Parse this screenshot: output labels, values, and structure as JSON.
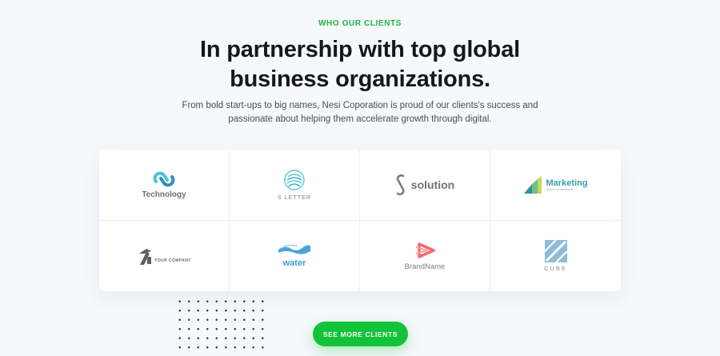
{
  "section": {
    "eyebrow": "WHO OUR CLIENTS",
    "headline_line1": "In partnership with top global",
    "headline_line2": "business organizations.",
    "subtext_line1": "From bold start-ups to big names, Nesi Coporation is proud of our clients's success and",
    "subtext_line2": "passionate about helping them accelerate growth through digital."
  },
  "clients": [
    {
      "name": "Technology",
      "icon": "technology-logo-icon"
    },
    {
      "name": "S LETTER",
      "icon": "s-letter-logo-icon"
    },
    {
      "name": "solution",
      "icon": "solution-logo-icon"
    },
    {
      "name": "Marketing",
      "tagline": "Return on Investment",
      "icon": "marketing-logo-icon"
    },
    {
      "name": "YOUR COMPANY",
      "icon": "your-company-logo-icon"
    },
    {
      "name": "water",
      "icon": "water-logo-icon"
    },
    {
      "name": "BrandName",
      "icon": "brandname-logo-icon"
    },
    {
      "name": "CUBE",
      "icon": "cube-logo-icon"
    }
  ],
  "cta": {
    "label": "SEE MORE CLIENTS"
  },
  "colors": {
    "accent": "#12c33a",
    "eyebrow": "#1cb83a",
    "background": "#f6f8fc"
  }
}
